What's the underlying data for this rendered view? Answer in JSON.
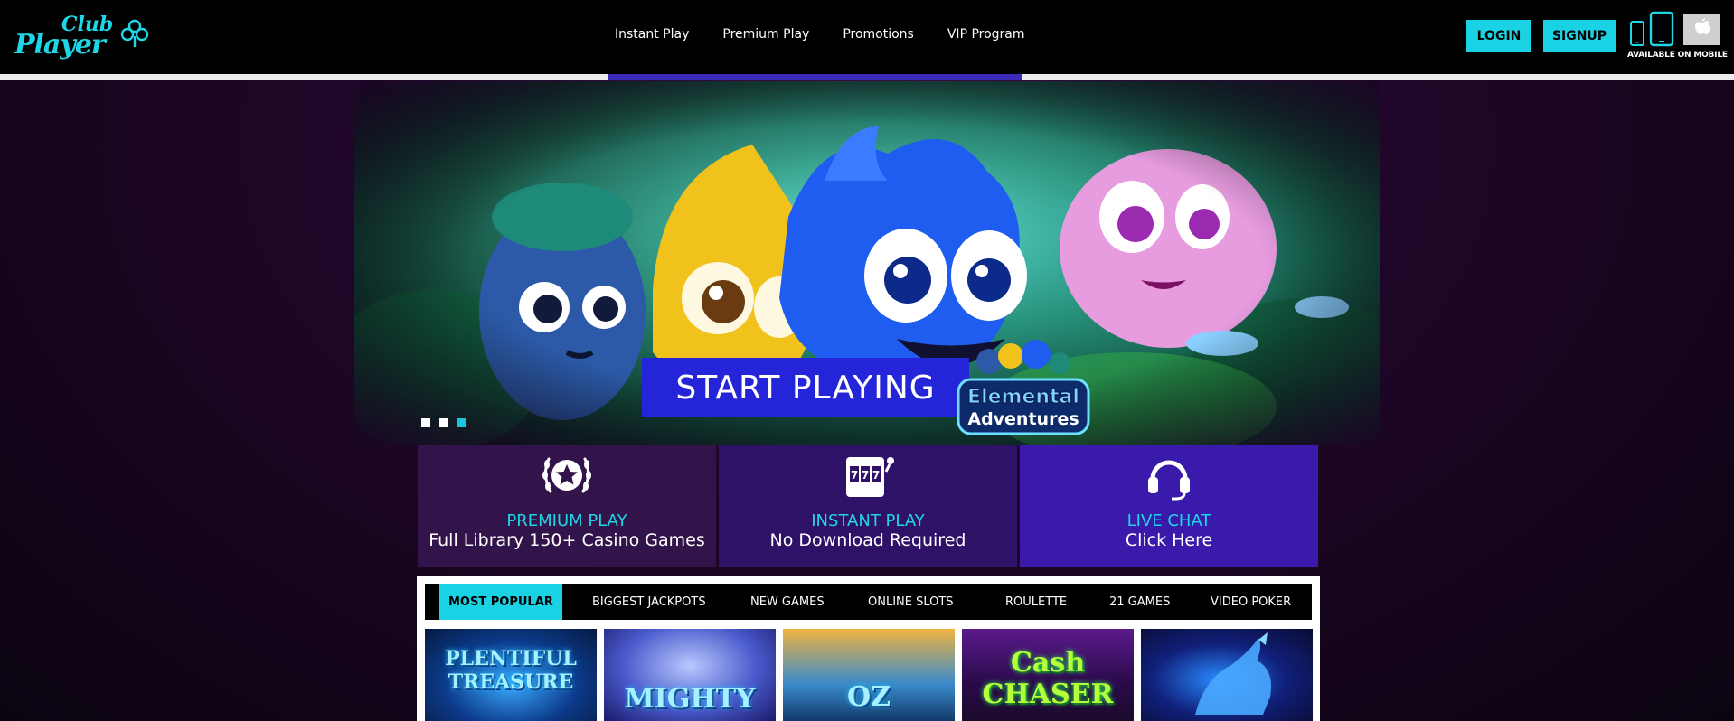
{
  "brand": {
    "logo_top": "Club",
    "logo_bottom": "Player"
  },
  "nav": [
    {
      "label": "Instant Play"
    },
    {
      "label": "Premium Play"
    },
    {
      "label": "Promotions"
    },
    {
      "label": "VIP Program"
    }
  ],
  "auth": {
    "login_label": "LOGIN",
    "signup_label": "SIGNUP"
  },
  "mobile": {
    "caption": "AVAILABLE ON MOBILE"
  },
  "hero": {
    "cta_label": "START PLAYING",
    "game_logo_line1": "Elemental",
    "game_logo_line2": "Adventures",
    "slides": 3,
    "active_slide": 3
  },
  "features": [
    {
      "title": "PREMIUM PLAY",
      "subtitle": "Full Library 150+ Casino Games",
      "icon": "star-laurel-icon"
    },
    {
      "title": "INSTANT PLAY",
      "subtitle": "No Download Required",
      "icon": "slot-machine-icon"
    },
    {
      "title": "LIVE CHAT",
      "subtitle": "Click Here",
      "icon": "headset-icon"
    }
  ],
  "game_tabs": [
    {
      "label": "MOST POPULAR",
      "active": true
    },
    {
      "label": "BIGGEST JACKPOTS"
    },
    {
      "label": "NEW GAMES"
    },
    {
      "label": "ONLINE SLOTS"
    },
    {
      "label": "ROULETTE"
    },
    {
      "label": "21 GAMES"
    },
    {
      "label": "VIDEO POKER"
    }
  ],
  "game_thumbs": [
    {
      "label": "PLENTIFUL TREASURE"
    },
    {
      "label": "MIGHTY"
    },
    {
      "label": "OZ"
    },
    {
      "label": "Cash CHASER"
    },
    {
      "label": ""
    }
  ],
  "colors": {
    "accent": "#19d2e4",
    "cta": "#2424d8",
    "header_bg": "#000000"
  }
}
